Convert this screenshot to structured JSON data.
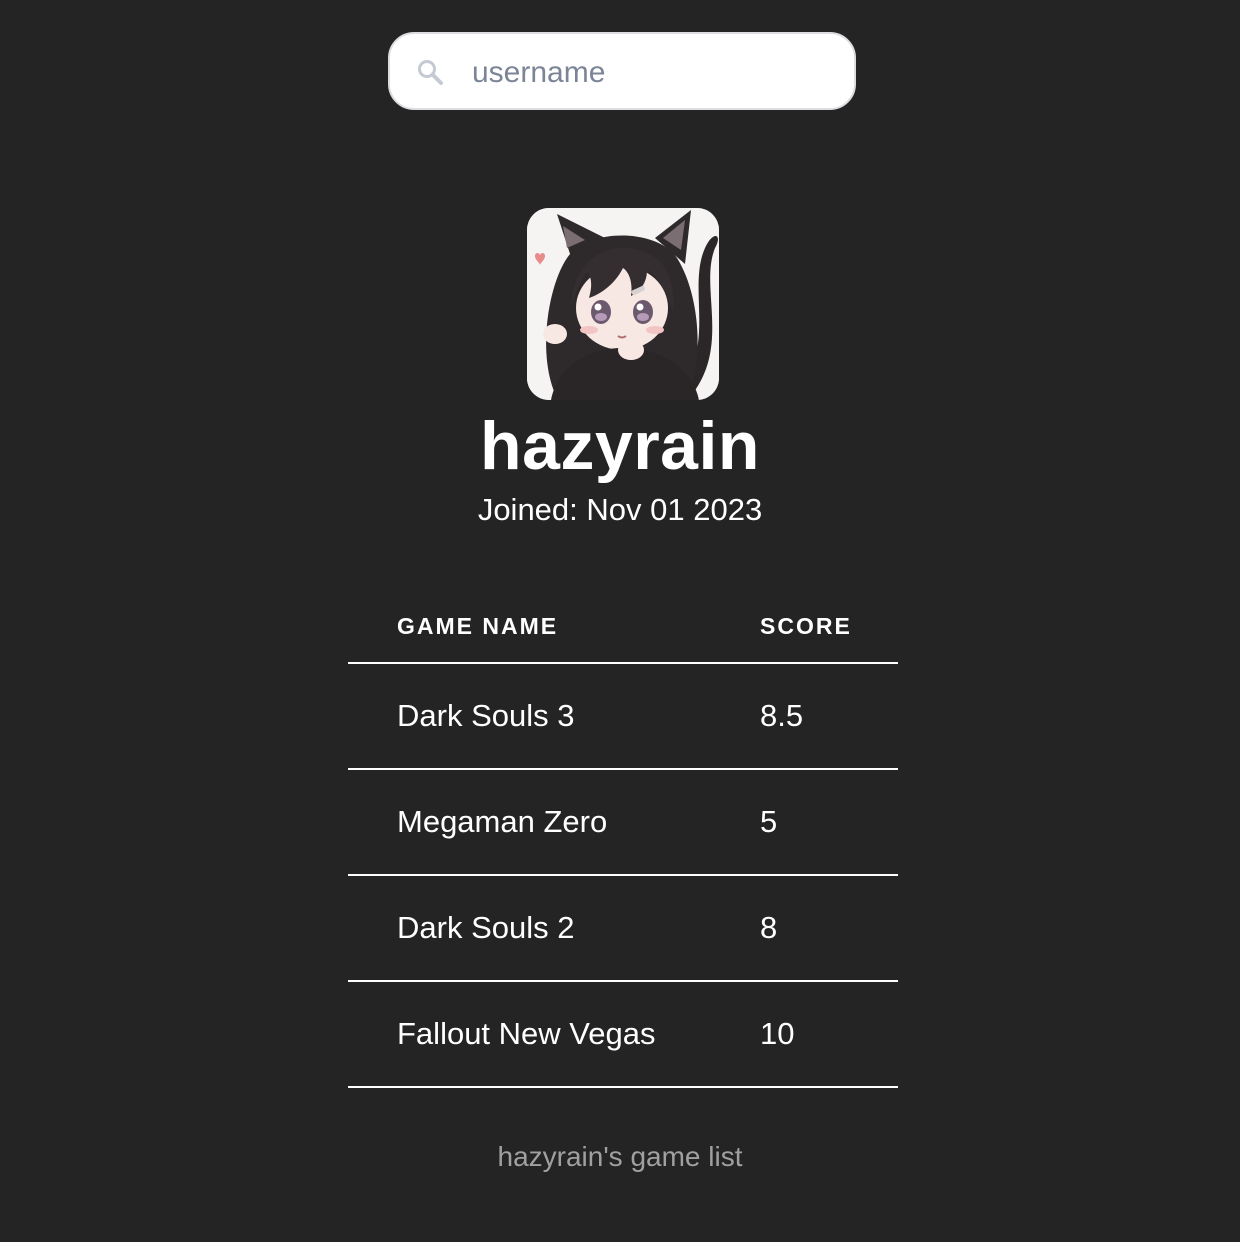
{
  "search": {
    "placeholder": "username",
    "value": "",
    "icon": "search-icon"
  },
  "profile": {
    "avatar_icon": "avatar-cat-girl",
    "username": "hazyrain",
    "joined": "Joined: Nov 01 2023"
  },
  "table": {
    "headers": [
      "GAME NAME",
      "SCORE"
    ],
    "rows": [
      {
        "name": "Dark Souls 3",
        "score": "8.5"
      },
      {
        "name": "Megaman Zero",
        "score": "5"
      },
      {
        "name": "Dark Souls 2",
        "score": "8"
      },
      {
        "name": "Fallout New Vegas",
        "score": "10"
      }
    ]
  },
  "footer": {
    "caption": "hazyrain's game list"
  },
  "colors": {
    "background": "#242424",
    "text": "#ffffff",
    "caption": "#a0a0a0"
  }
}
